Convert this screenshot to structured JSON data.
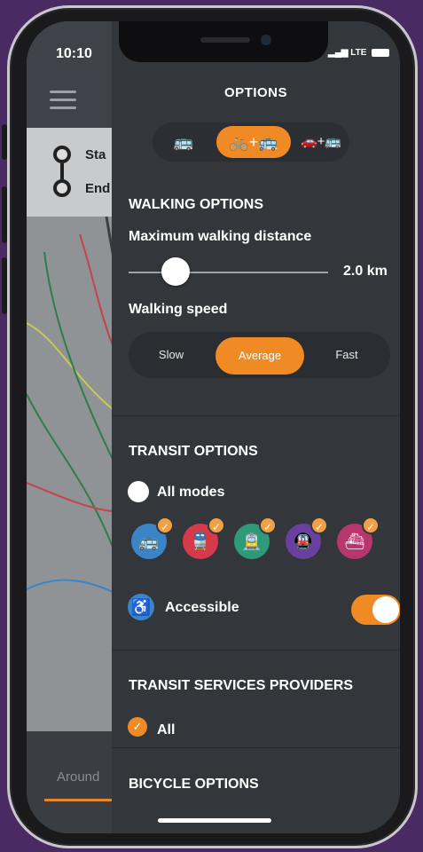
{
  "status": {
    "time": "10:10",
    "carrier": "LTE"
  },
  "background_app": {
    "start_label": "Sta",
    "end_label": "End",
    "bottom_tab": "Around"
  },
  "options": {
    "title": "OPTIONS",
    "mode_tabs": [
      {
        "icon": "bus-icon",
        "active": false
      },
      {
        "icon": "bike-plus-bus-icon",
        "active": true
      },
      {
        "icon": "car-plus-bus-icon",
        "active": false
      }
    ],
    "walking": {
      "heading": "WALKING OPTIONS",
      "max_distance_label": "Maximum walking distance",
      "max_distance_value": "2.0 km",
      "speed_label": "Walking speed",
      "speeds": [
        "Slow",
        "Average",
        "Fast"
      ],
      "selected_speed": "Average"
    },
    "transit": {
      "heading": "TRANSIT OPTIONS",
      "all_modes_label": "All modes",
      "modes": [
        {
          "name": "bus",
          "color": "#3a84c7",
          "checked": true
        },
        {
          "name": "train",
          "color": "#d63a4a",
          "checked": true
        },
        {
          "name": "tram",
          "color": "#2e9a7a",
          "checked": true
        },
        {
          "name": "metro",
          "color": "#6a3fa0",
          "checked": true
        },
        {
          "name": "ferry",
          "color": "#b8366e",
          "checked": true
        }
      ],
      "accessible_label": "Accessible",
      "accessible_on": true
    },
    "providers": {
      "heading": "TRANSIT SERVICES PROVIDERS",
      "all_label": "All"
    },
    "bicycle": {
      "heading": "BICYCLE OPTIONS"
    }
  },
  "colors": {
    "accent": "#f08a25",
    "panel": "#33373c"
  }
}
